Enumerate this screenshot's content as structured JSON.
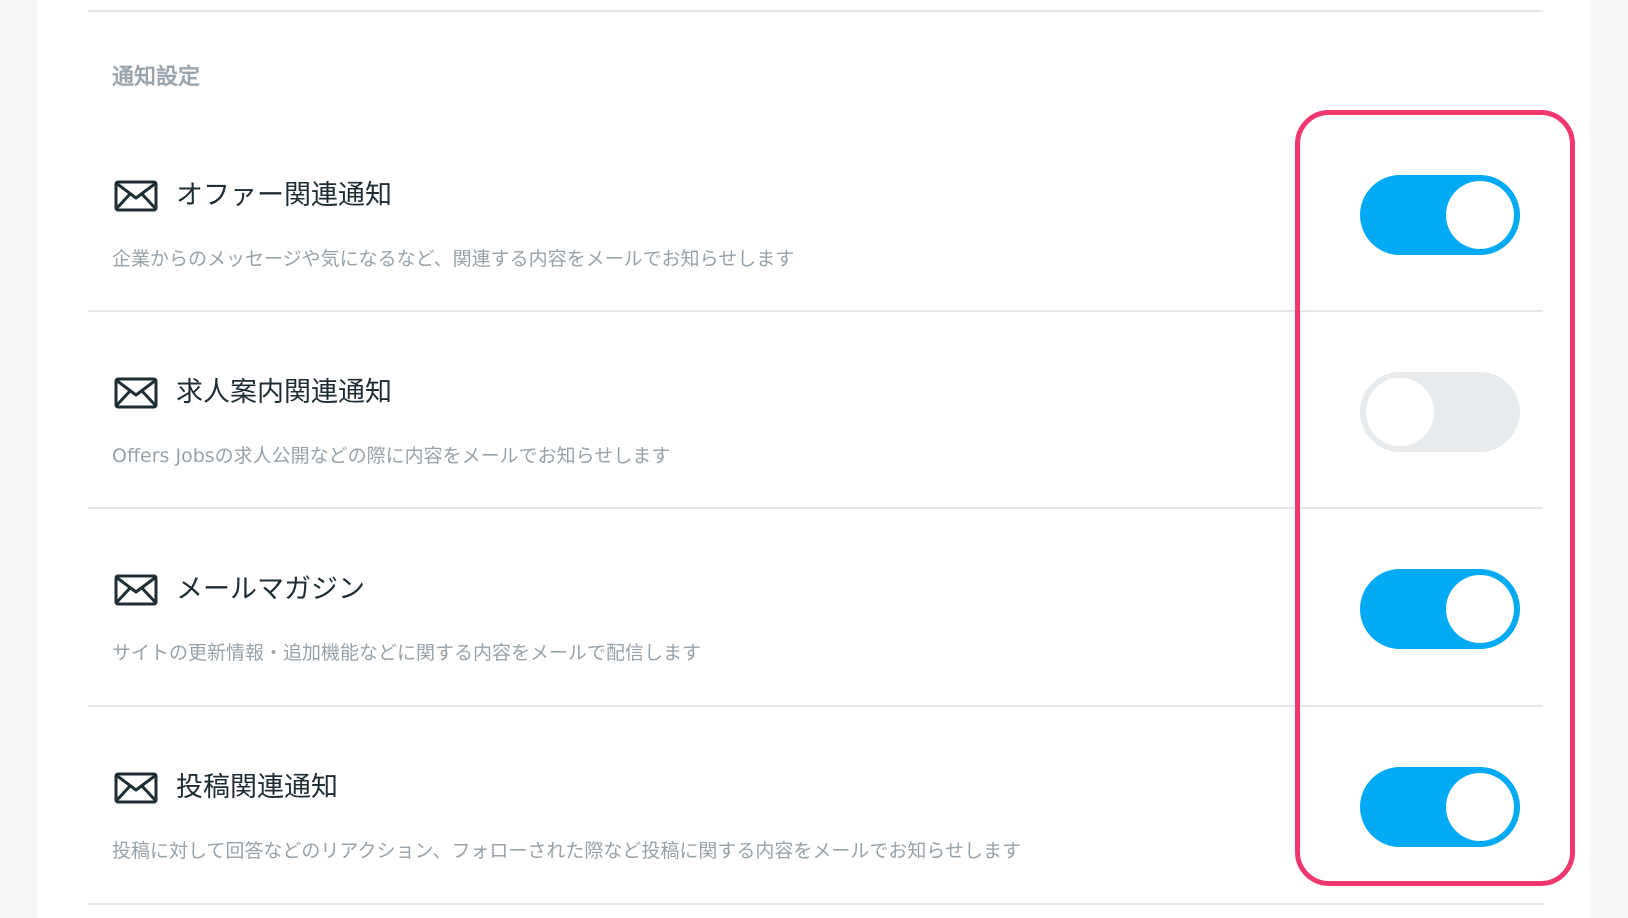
{
  "section": {
    "title": "通知設定"
  },
  "rows": [
    {
      "title": "オファー関連通知",
      "description": "企業からのメッセージや気になるなど、関連する内容をメールでお知らせします",
      "enabled": true,
      "icon": "mail-icon"
    },
    {
      "title": "求人案内関連通知",
      "description": "Offers Jobsの求人公開などの際に内容をメールでお知らせします",
      "enabled": false,
      "icon": "mail-icon"
    },
    {
      "title": "メールマガジン",
      "description": "サイトの更新情報・追加機能などに関する内容をメールで配信します",
      "enabled": true,
      "icon": "mail-icon"
    },
    {
      "title": "投稿関連通知",
      "description": "投稿に対して回答などのリアクション、フォローされた際など投稿に関する内容をメールでお知らせします",
      "enabled": true,
      "icon": "mail-icon"
    }
  ],
  "colors": {
    "toggle_on": "#00aaf5",
    "toggle_off": "#e8ebed",
    "highlight": "#f0386e"
  }
}
